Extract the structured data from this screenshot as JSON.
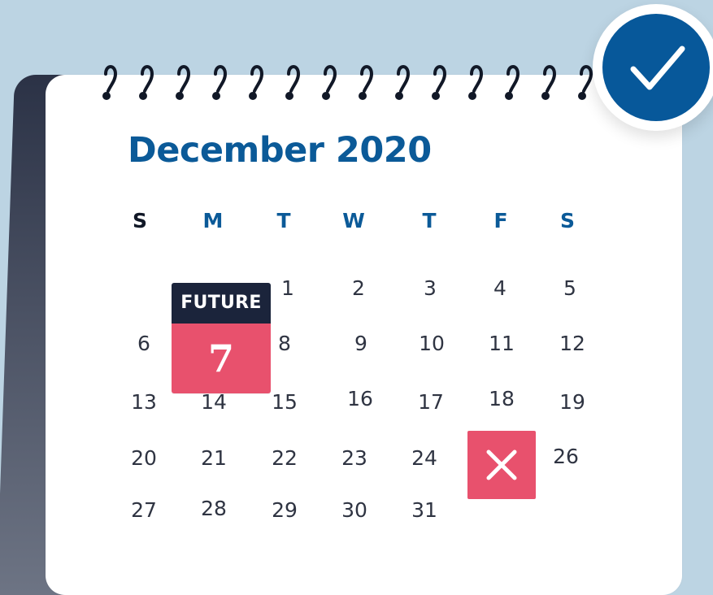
{
  "calendar": {
    "month_title": "December 2020",
    "weekdays": [
      "S",
      "M",
      "T",
      "W",
      "T",
      "F",
      "S"
    ],
    "days": {
      "d1": "1",
      "d2": "2",
      "d3": "3",
      "d4": "4",
      "d5": "5",
      "d6": "6",
      "d8": "8",
      "d9": "9",
      "d10": "10",
      "d11": "11",
      "d12": "12",
      "d13": "13",
      "d14": "14",
      "d15": "15",
      "d16": "16",
      "d17": "17",
      "d18": "18",
      "d19": "19",
      "d20": "20",
      "d21": "21",
      "d22": "22",
      "d23": "23",
      "d24": "24",
      "d26": "26",
      "d27": "27",
      "d28": "28",
      "d29": "29",
      "d30": "30",
      "d31": "31"
    },
    "future_badge": {
      "label": "FUTURE",
      "day": "7"
    },
    "cancelled_day_icon": "close-icon",
    "confirm_icon": "check-icon"
  },
  "colors": {
    "background": "#bcd4e3",
    "accent_blue": "#0b5a98",
    "accent_red": "#e8516d",
    "navy": "#1b243b"
  }
}
